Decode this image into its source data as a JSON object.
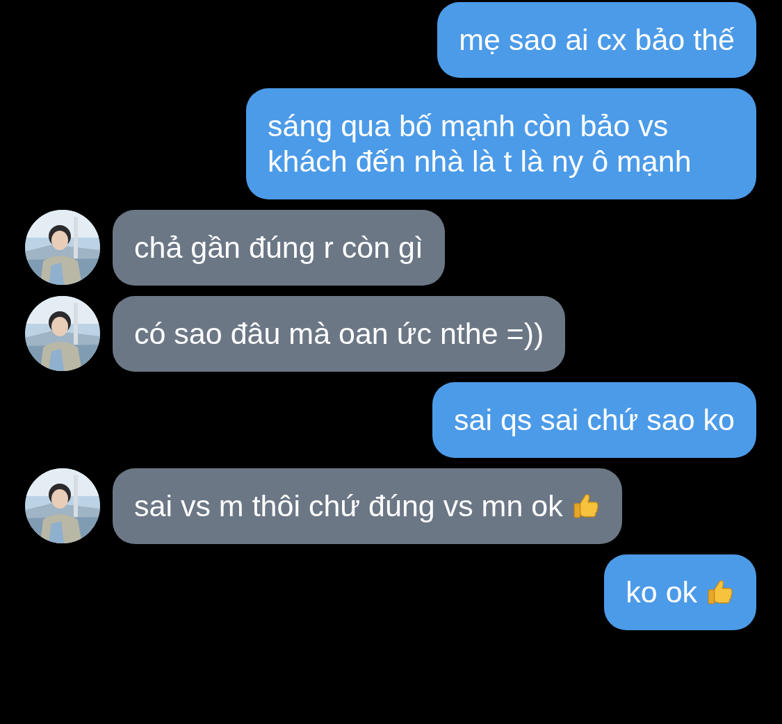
{
  "messages": [
    {
      "kind": "out",
      "text": "mẹ sao ai cx bảo thế",
      "thumbs_up": false
    },
    {
      "kind": "out",
      "text": "sáng qua bố mạnh còn bảo vs khách đến nhà là t là ny ô mạnh",
      "thumbs_up": false
    },
    {
      "kind": "in",
      "text": "chả gần đúng r còn gì",
      "thumbs_up": false
    },
    {
      "kind": "in",
      "text": "có sao đâu mà oan ức nthe =))",
      "thumbs_up": false
    },
    {
      "kind": "out",
      "text": "sai qs sai chứ sao ko",
      "thumbs_up": false
    },
    {
      "kind": "in",
      "text": "sai vs m thôi chứ đúng vs mn ok",
      "thumbs_up": true
    },
    {
      "kind": "out",
      "text": "ko ok",
      "thumbs_up": true
    }
  ]
}
